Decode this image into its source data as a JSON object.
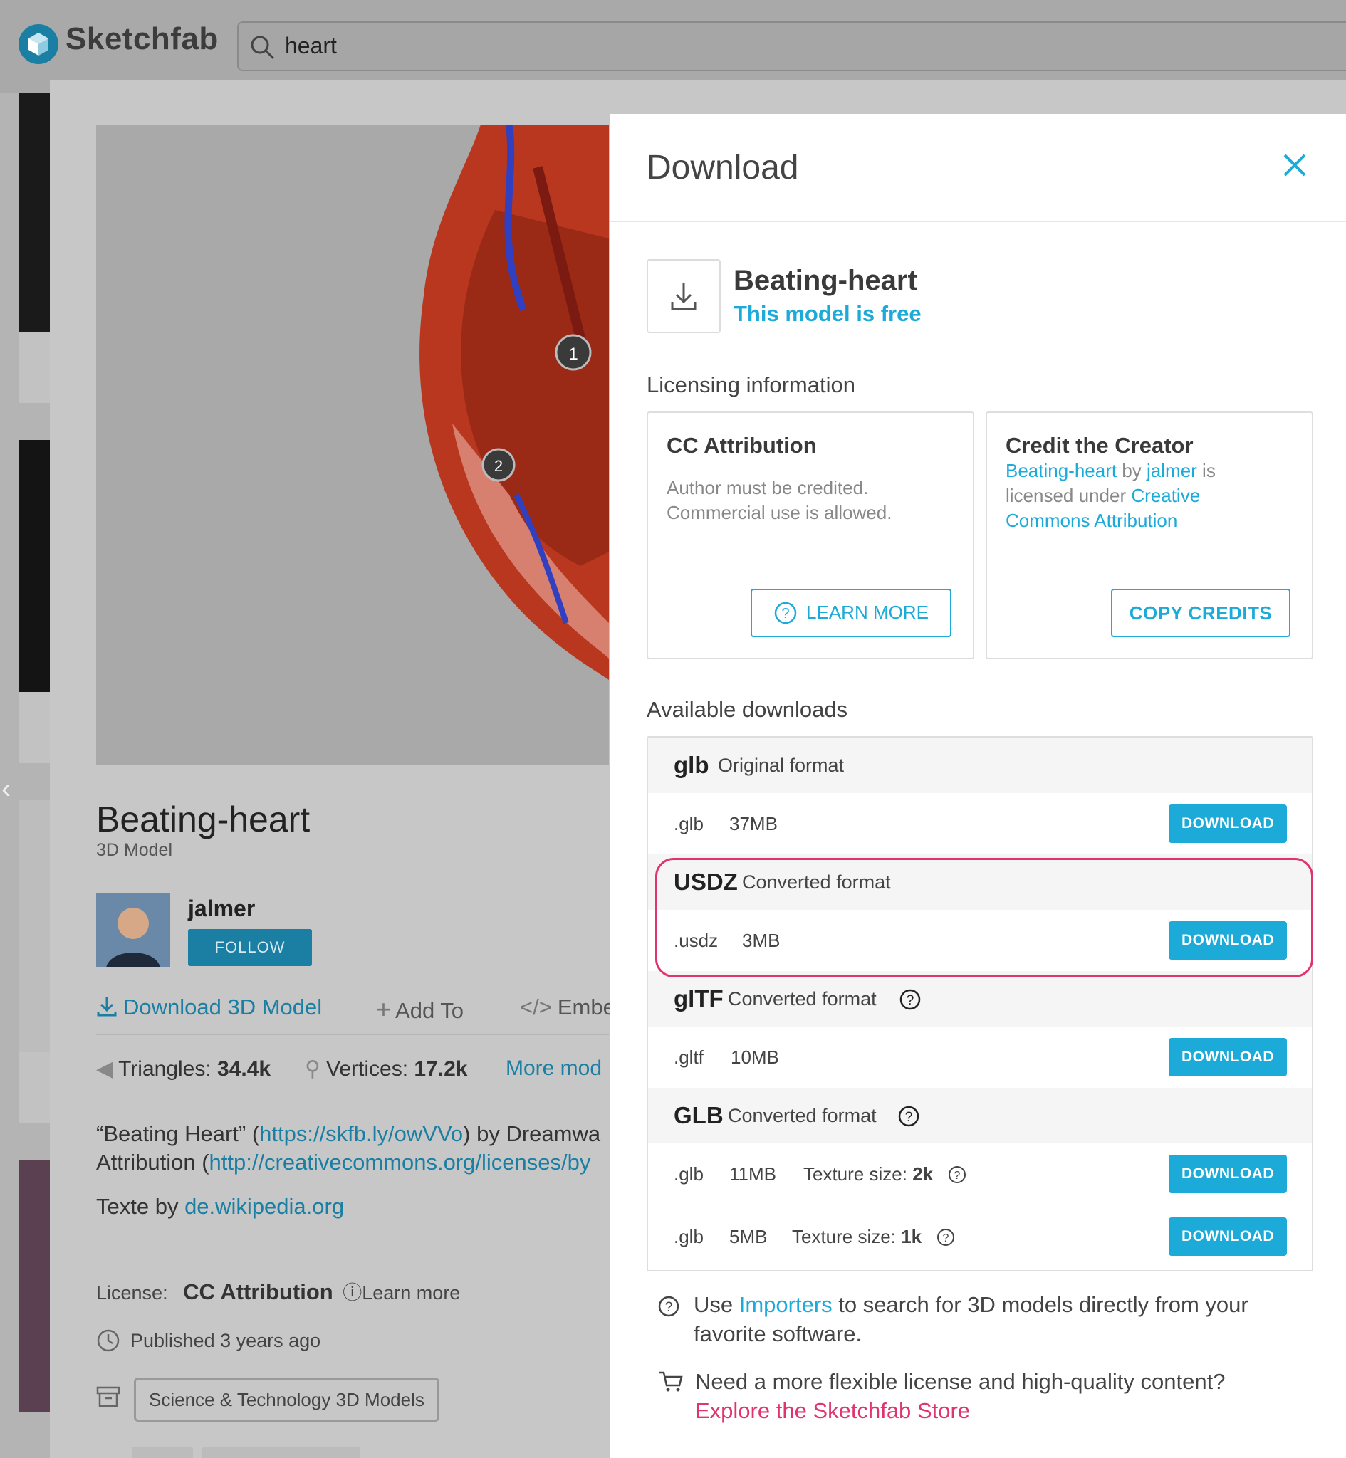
{
  "header": {
    "brand": "Sketchfab",
    "search_value": "heart"
  },
  "model_page": {
    "title": "Beating-heart",
    "subtitle": "3D Model",
    "author": "jalmer",
    "follow_label": "FOLLOW",
    "actions": {
      "download": "Download 3D Model",
      "add_to": "Add To",
      "embed": "Embe"
    },
    "stats": {
      "triangles_label": "Triangles:",
      "triangles_value": "34.4k",
      "vertices_label": "Vertices:",
      "vertices_value": "17.2k",
      "more_label": "More mod"
    },
    "description": {
      "line1_a": "“Beating Heart” (",
      "line1_link": "https://skfb.ly/owVVo",
      "line1_b": ") by Dreamwa",
      "line2_a": "Attribution (",
      "line2_link": "http://creativecommons.org/licenses/by",
      "line3_a": "Texte by ",
      "line3_link": "de.wikipedia.org"
    },
    "license_label": "License:",
    "license_value": "CC Attribution",
    "license_learn": "Learn more",
    "published": "Published 3 years ago",
    "category": "Science & Technology 3D Models",
    "viewer_annotations": [
      "1",
      "2"
    ]
  },
  "download_panel": {
    "title": "Download",
    "model_name": "Beating-heart",
    "free_label": "This model is free",
    "licensing_heading": "Licensing information",
    "license_box": {
      "title": "CC Attribution",
      "text_line1": "Author must be credited.",
      "text_line2": "Commercial use is allowed.",
      "button": "LEARN MORE"
    },
    "credit_box": {
      "title": "Credit the Creator",
      "model_link": "Beating-heart",
      "by": " by ",
      "author_link": "jalmer",
      "is": " is",
      "licensed_under": "licensed under ",
      "license_link_a": "Creative",
      "license_link_b": "Commons Attribution",
      "button": "COPY CREDITS"
    },
    "available_heading": "Available downloads",
    "formats": [
      {
        "name": "glb",
        "type": "Original format",
        "files": [
          {
            "ext": ".glb",
            "size": "37MB",
            "button": "DOWNLOAD"
          }
        ]
      },
      {
        "name": "USDZ",
        "type": "Converted format",
        "files": [
          {
            "ext": ".usdz",
            "size": "3MB",
            "button": "DOWNLOAD"
          }
        ]
      },
      {
        "name": "glTF",
        "type": "Converted format",
        "files": [
          {
            "ext": ".gltf",
            "size": "10MB",
            "button": "DOWNLOAD"
          }
        ]
      },
      {
        "name": "GLB",
        "type": "Converted format",
        "files": [
          {
            "ext": ".glb",
            "size": "11MB",
            "texture_label": "Texture size:",
            "texture_value": "2k",
            "button": "DOWNLOAD"
          },
          {
            "ext": ".glb",
            "size": "5MB",
            "texture_label": "Texture size:",
            "texture_value": "1k",
            "button": "DOWNLOAD"
          }
        ]
      }
    ],
    "tip_importers_a": "Use ",
    "tip_importers_link": "Importers",
    "tip_importers_b": " to search for 3D models directly from your favorite software.",
    "tip_store_text": "Need a more flexible license and high-quality content?",
    "tip_store_link": "Explore the Sketchfab Store"
  },
  "colors": {
    "accent": "#1caad9",
    "highlight": "#e0336f",
    "store_link": "#e0336f"
  },
  "icons": [
    "sketchfab-logo-icon",
    "search-icon",
    "close-icon",
    "download-icon",
    "help-icon",
    "cart-icon",
    "clock-icon",
    "archive-icon",
    "triangle-icon",
    "vertex-icon",
    "plus-icon",
    "code-icon"
  ]
}
